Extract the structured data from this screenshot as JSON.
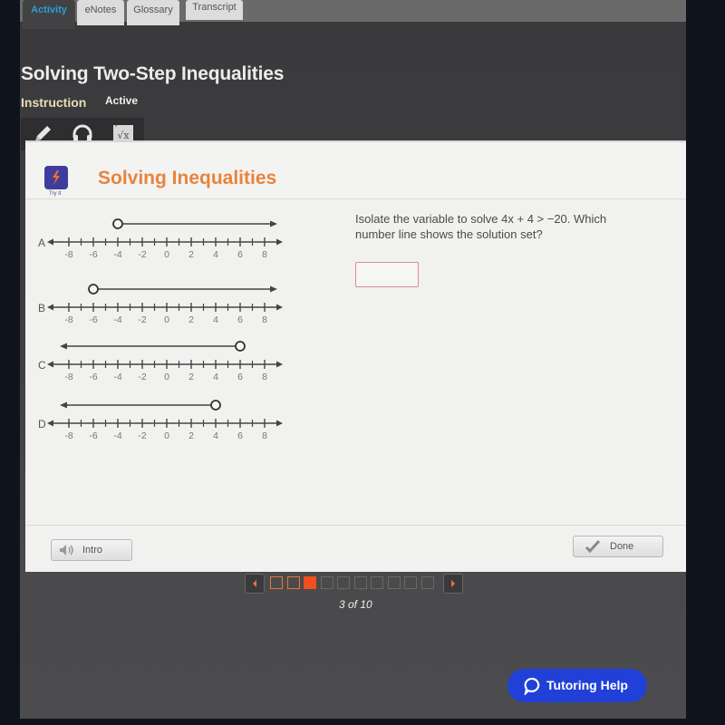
{
  "tabs": [
    {
      "label": "Activity",
      "active": true
    },
    {
      "label": "eNotes",
      "active": false
    },
    {
      "label": "Glossary",
      "active": false
    },
    {
      "label": "Transcript",
      "active": false
    }
  ],
  "page": {
    "title": "Solving Two-Step Inequalities",
    "mode": "Instruction",
    "status": "Active"
  },
  "toolbar": {
    "tools": [
      {
        "icon": "pencil-icon"
      },
      {
        "icon": "headphones-icon"
      },
      {
        "icon": "square-root-icon",
        "glyph": "√x"
      }
    ]
  },
  "card": {
    "badge_label": "Try It",
    "title": "Solving Inequalities",
    "question_text": "Isolate the variable to solve 4x + 4 > −20. Which number line shows the solution set?",
    "answer_value": "",
    "options": [
      {
        "label": "A",
        "point": -4,
        "direction": "right",
        "open": true
      },
      {
        "label": "B",
        "point": -6,
        "direction": "right",
        "open": true
      },
      {
        "label": "C",
        "point": 6,
        "direction": "left",
        "open": true
      },
      {
        "label": "D",
        "point": 4,
        "direction": "left",
        "open": true
      }
    ],
    "tick_labels": [
      "-8",
      "-6",
      "-4",
      "-2",
      "0",
      "2",
      "4",
      "6",
      "8"
    ],
    "intro_label": "Intro",
    "done_label": "Done"
  },
  "pager": {
    "current": 3,
    "total": 10,
    "label": "3 of 10"
  },
  "tutoring": {
    "label": "Tutoring Help"
  },
  "colors": {
    "accent_orange": "#e8843c",
    "active_tab_blue": "#2a9fd6",
    "tutoring_blue": "#2140d8",
    "pager_current": "#f0501e"
  }
}
